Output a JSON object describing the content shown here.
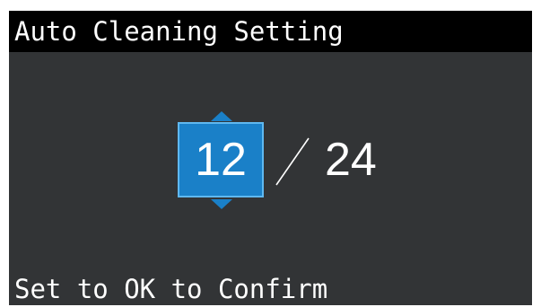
{
  "screen": {
    "title": "Auto Cleaning Setting",
    "hint": "Set to OK to Confirm"
  },
  "setting": {
    "current_value": "12",
    "max_value": "24",
    "separator_icon": "slash-separator-icon",
    "increase_icon": "up-arrow-icon",
    "decrease_icon": "down-arrow-icon"
  },
  "colors": {
    "screen_background": "#323436",
    "title_bar_background": "#000000",
    "accent": "#1a80c8",
    "text": "#ffffff"
  }
}
